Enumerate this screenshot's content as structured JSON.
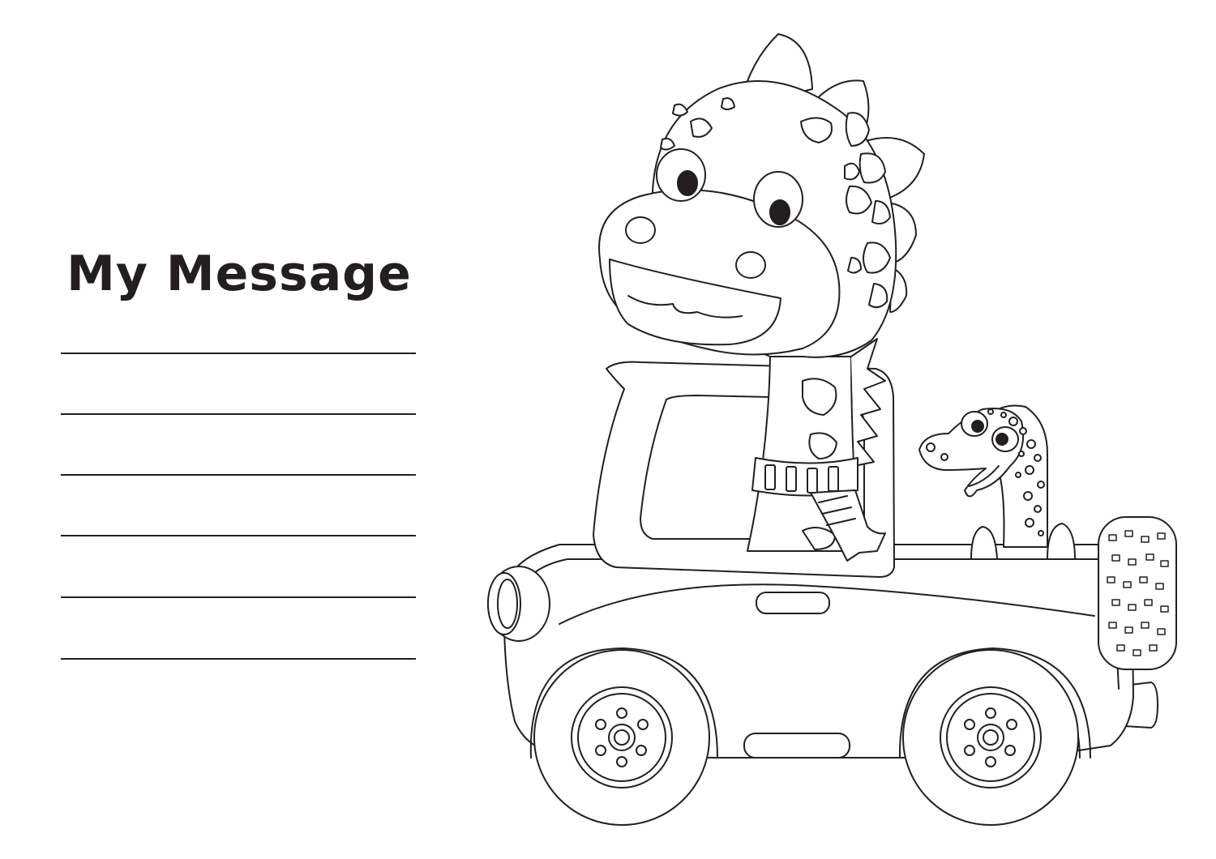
{
  "title": "My Message",
  "writing_line_count": 6,
  "colors": {
    "ink": "#231f20",
    "paper": "#ffffff"
  }
}
